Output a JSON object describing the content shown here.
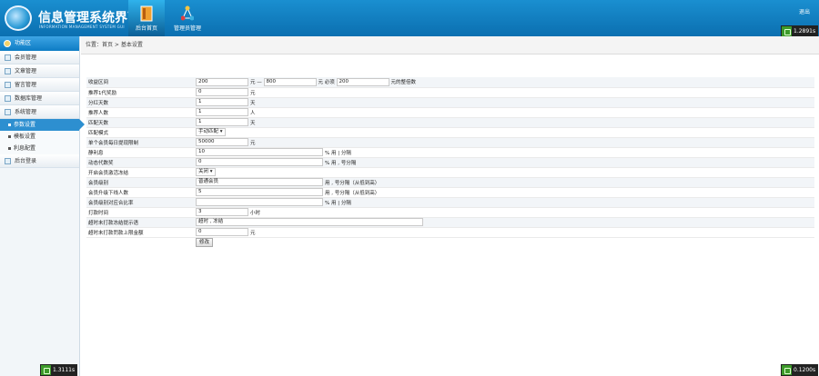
{
  "header": {
    "title": "信息管理系统界面",
    "subtitle": "INFORMATION MANAGEMENT SYSTEM GUI",
    "tabs": [
      {
        "label": "后台首页",
        "active": true
      },
      {
        "label": "管理员管理",
        "active": false
      }
    ],
    "exit_label": "退出",
    "timer_top": "1.2891s",
    "timer_bottom_left": "1.3111s",
    "timer_bottom_right": "0.1200s"
  },
  "sidebar": {
    "head": "功能区",
    "items": [
      {
        "label": "会员管理"
      },
      {
        "label": "文章管理"
      },
      {
        "label": "留言管理"
      },
      {
        "label": "数据库管理"
      },
      {
        "label": "系统管理"
      }
    ],
    "sub_items": [
      {
        "label": "参数设置",
        "active": true
      },
      {
        "label": "模板设置",
        "active": false
      },
      {
        "label": "利息配置",
        "active": false
      }
    ],
    "last_item": "后台登录"
  },
  "breadcrumb": "位置：首页 > 基本设置",
  "form": {
    "row_range": {
      "label": "收益区间",
      "v1": "200",
      "t1": "元 — ",
      "v2": "800",
      "t2": "元 必须",
      "v3": "200",
      "t3": "元的整倍数"
    },
    "rows": [
      {
        "label": "推荐1代奖励",
        "value": "0",
        "unit": "元"
      },
      {
        "label": "分红天数",
        "value": "1",
        "unit": "天"
      },
      {
        "label": "推荐人数",
        "value": "1",
        "unit": "人"
      },
      {
        "label": "匹配天数",
        "value": "1",
        "unit": "天"
      }
    ],
    "mode": {
      "label": "匹配模式",
      "value": "手动匹配"
    },
    "limit": {
      "label": "单个会员每日提现限制",
      "value": "50000",
      "unit": "元"
    },
    "rate": {
      "label": "静利息",
      "value": "10",
      "unit": "% 用 | 分隔"
    },
    "dyn": {
      "label": "动态代数奖",
      "value": "0",
      "unit": "% 用 , 号分隔"
    },
    "open_reg": {
      "label": "开启会员激活冻结",
      "value": "关闭"
    },
    "level": {
      "label": "会员级别",
      "value": "普通会员",
      "unit": "用 , 号分隔（从低到高）"
    },
    "upgrade": {
      "label": "会员升级下线人数",
      "value": "5",
      "unit": "用 , 号分隔（从低到高）"
    },
    "level_rate": {
      "label": "会员级别对应合比率",
      "value": "",
      "unit": "% 用 | 分隔"
    },
    "pay_time": {
      "label": "打款时间",
      "value": "3",
      "unit": "小时"
    },
    "notice": {
      "label": "超时未打款冻结提示语",
      "value": "超时 , 冻结"
    },
    "fine": {
      "label": "超时未打款罚款上限金额",
      "value": "0",
      "unit": "元"
    },
    "submit": "修改"
  }
}
